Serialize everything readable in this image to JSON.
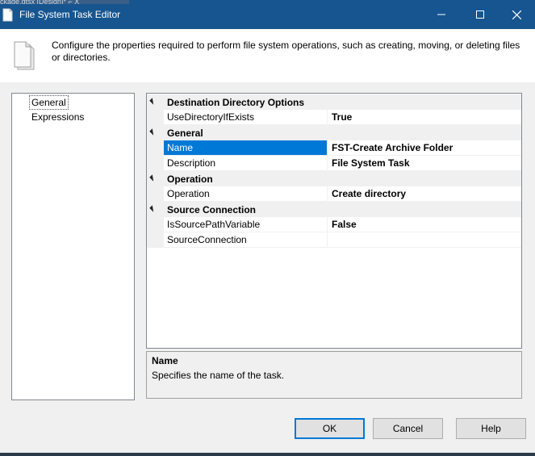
{
  "window": {
    "title": "File System Task Editor",
    "background_text": "ckage.dtsx [Design]* ⌐ X"
  },
  "header": {
    "description": "Configure the properties required to perform file system operations, such as creating, moving, or deleting files or directories."
  },
  "nav": {
    "items": [
      {
        "label": "General",
        "selected": true
      },
      {
        "label": "Expressions",
        "selected": false
      }
    ]
  },
  "grid": {
    "categories": [
      {
        "label": "Destination Directory Options",
        "properties": [
          {
            "name": "UseDirectoryIfExists",
            "value": "True"
          }
        ]
      },
      {
        "label": "General",
        "properties": [
          {
            "name": "Name",
            "value": "FST-Create Archive Folder",
            "selected": true
          },
          {
            "name": "Description",
            "value": "File System Task"
          }
        ]
      },
      {
        "label": "Operation",
        "properties": [
          {
            "name": "Operation",
            "value": "Create directory"
          }
        ]
      },
      {
        "label": "Source Connection",
        "properties": [
          {
            "name": "IsSourcePathVariable",
            "value": "False"
          },
          {
            "name": "SourceConnection",
            "value": ""
          }
        ]
      }
    ]
  },
  "description_panel": {
    "title": "Name",
    "text": "Specifies the name of the task."
  },
  "buttons": {
    "ok": "OK",
    "cancel": "Cancel",
    "help": "Help"
  },
  "colors": {
    "titlebar": "#16558f",
    "selection": "#0078d7",
    "accent_border": "#0078d7"
  }
}
